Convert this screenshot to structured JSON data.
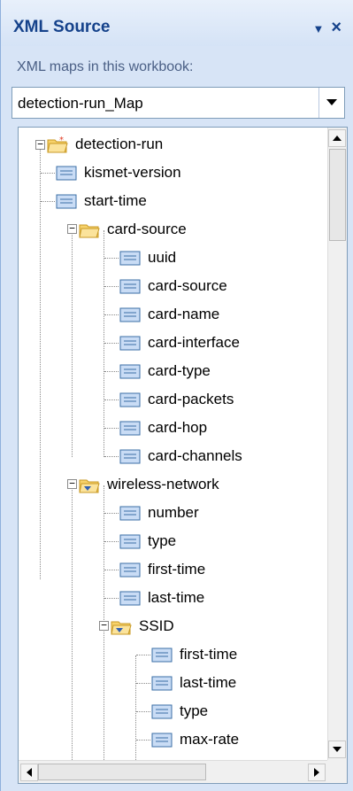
{
  "header": {
    "title": "XML Source",
    "dropdown_glyph": "▼",
    "close_glyph": "×"
  },
  "maps_label": "XML maps in this workbook:",
  "map_select": {
    "value": "detection-run_Map"
  },
  "tree": {
    "root": "detection-run",
    "items": [
      "kismet-version",
      "start-time",
      "card-source",
      "uuid",
      "card-source",
      "card-name",
      "card-interface",
      "card-type",
      "card-packets",
      "card-hop",
      "card-channels",
      "wireless-network",
      "number",
      "type",
      "first-time",
      "last-time",
      "SSID",
      "first-time",
      "last-time",
      "type",
      "max-rate"
    ]
  }
}
